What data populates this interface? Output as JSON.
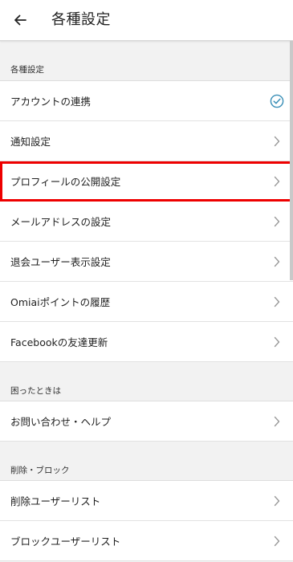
{
  "header": {
    "title": "各種設定",
    "back_icon": "arrow-left-icon"
  },
  "sections": [
    {
      "header": "各種設定",
      "items": [
        {
          "label": "アカウントの連携",
          "trailing": "check-circle-icon"
        },
        {
          "label": "通知設定",
          "trailing": "chevron-right-icon"
        },
        {
          "label": "プロフィールの公開設定",
          "trailing": "chevron-right-icon",
          "highlighted": true
        },
        {
          "label": "メールアドレスの設定",
          "trailing": "chevron-right-icon"
        },
        {
          "label": "退会ユーザー表示設定",
          "trailing": "chevron-right-icon"
        },
        {
          "label": "Omiaiポイントの履歴",
          "trailing": "chevron-right-icon"
        },
        {
          "label": "Facebookの友達更新",
          "trailing": "chevron-right-icon"
        }
      ]
    },
    {
      "header": "困ったときは",
      "items": [
        {
          "label": "お問い合わせ・ヘルプ",
          "trailing": "chevron-right-icon"
        }
      ]
    },
    {
      "header": "削除・ブロック",
      "items": [
        {
          "label": "削除ユーザーリスト",
          "trailing": "chevron-right-icon"
        },
        {
          "label": "ブロックユーザーリスト",
          "trailing": "chevron-right-icon"
        }
      ]
    }
  ],
  "colors": {
    "highlight_border": "#ee0000",
    "check_icon": "#3a8fb7",
    "chevron": "#9a9a9a",
    "background": "#f2f2f2"
  }
}
